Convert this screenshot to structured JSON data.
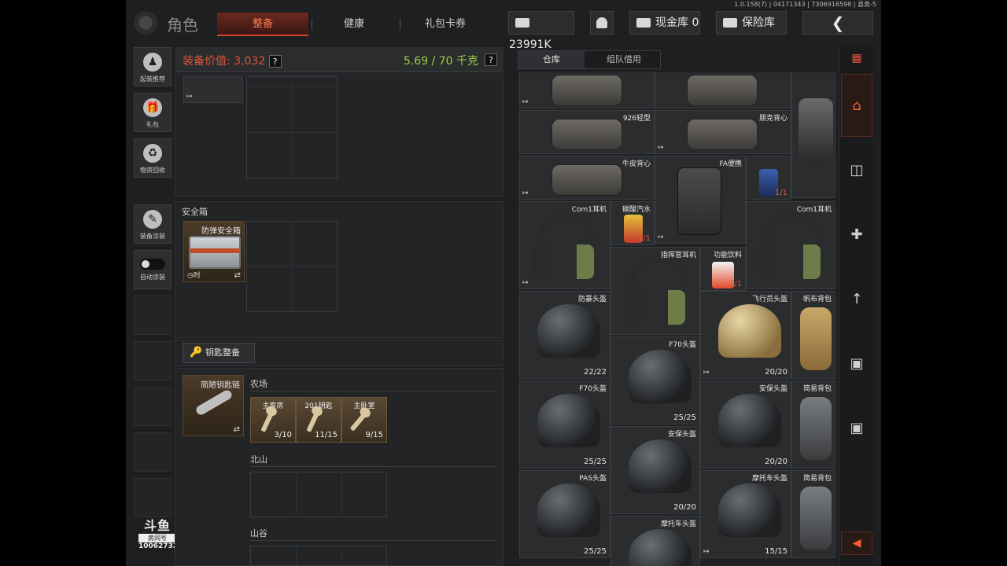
{
  "version": "1.0.158(7) | 04171343 | 7306916598 | 县类-5",
  "header": {
    "title": "角色",
    "tabs": [
      {
        "label": "整备",
        "active": true
      },
      {
        "label": "健康",
        "active": false
      },
      {
        "label": "礼包卡券",
        "active": false
      }
    ],
    "currency": "23991K",
    "cash_vault_label": "现金库 0",
    "safe_label": "保险库",
    "back_icon": "chevron-left-icon"
  },
  "sidebar": {
    "items": [
      {
        "label": "起装推荐",
        "icon": "loadout-icon"
      },
      {
        "label": "礼包",
        "icon": "gift-icon"
      },
      {
        "label": "物资回收",
        "icon": "recycle-icon"
      },
      {
        "label": "装备涂装",
        "icon": "paint-icon"
      },
      {
        "label": "自动涂装",
        "icon": "toggle-icon"
      }
    ],
    "watermark": {
      "brand": "斗鱼",
      "room_label": "房间号",
      "room_number": "10062732"
    }
  },
  "equipment": {
    "value_label": "装备价值: 3,032",
    "weight": "5.69 / 70 千克",
    "help": "?",
    "safe_box": {
      "title": "安全箱",
      "item_name": "防弹安全箱",
      "timer": "时"
    },
    "keys": {
      "button_label": "钥匙整备",
      "holder_name": "简陋钥匙链",
      "regions": [
        {
          "name": "农场",
          "keys": [
            {
              "name": "主客房",
              "count": "3/10"
            },
            {
              "name": "201钥匙",
              "count": "11/15"
            },
            {
              "name": "主卧室",
              "count": "9/15"
            }
          ]
        },
        {
          "name": "北山",
          "keys": []
        },
        {
          "name": "山谷",
          "keys": []
        }
      ]
    }
  },
  "warehouse": {
    "tabs": [
      {
        "label": "仓库",
        "active": true
      },
      {
        "label": "组队借用",
        "active": false
      }
    ],
    "items": [
      {
        "name": "",
        "count": "",
        "shape": "bag"
      },
      {
        "name": "",
        "count": "",
        "shape": "bag"
      },
      {
        "name": "",
        "count": "",
        "shape": "none"
      },
      {
        "name": "926轻型",
        "count": "",
        "shape": "bag"
      },
      {
        "name": "朋克背心",
        "count": "",
        "shape": "bag"
      },
      {
        "name": "",
        "count": "",
        "shape": "tube"
      },
      {
        "name": "牛皮背心",
        "count": "",
        "shape": "bag"
      },
      {
        "name": "FA便携",
        "count": "",
        "shape": "vest"
      },
      {
        "name": "",
        "count": "1/1",
        "shape": "can"
      },
      {
        "name": "Com1耳机",
        "count": "",
        "shape": "earmuff"
      },
      {
        "name": "碳酸汽水",
        "count": "1/1",
        "shape": "can"
      },
      {
        "name": "Com1耳机",
        "count": "",
        "shape": "earmuff"
      },
      {
        "name": "指挥官耳机",
        "count": "",
        "shape": "earmuff"
      },
      {
        "name": "功能饮料",
        "count": "1/1",
        "shape": "drink"
      },
      {
        "name": "防暴头盔",
        "count": "22/22",
        "shape": "helmet"
      },
      {
        "name": "F70头盔",
        "count": "25/25",
        "shape": "helmet"
      },
      {
        "name": "飞行员头盔",
        "count": "20/20",
        "shape": "helmet-tan"
      },
      {
        "name": "帆布背包",
        "count": "",
        "shape": "pack"
      },
      {
        "name": "F70头盔",
        "count": "25/25",
        "shape": "helmet"
      },
      {
        "name": "安保头盔",
        "count": "20/20",
        "shape": "helmet"
      },
      {
        "name": "简易背包",
        "count": "",
        "shape": "pack-gray"
      },
      {
        "name": "安保头盔",
        "count": "20/20",
        "shape": "helmet"
      },
      {
        "name": "PAS头盔",
        "count": "25/25",
        "shape": "helmet"
      },
      {
        "name": "摩托车头盔",
        "count": "15/15",
        "shape": "helmet"
      },
      {
        "name": "简易背包",
        "count": "",
        "shape": "pack-gray"
      },
      {
        "name": "摩托车头盔",
        "count": "",
        "shape": "helmet"
      }
    ]
  },
  "rail": {
    "items": [
      "menu-icon",
      "home-icon",
      "box-icon",
      "medkit-icon",
      "ammo-icon",
      "crate-icon",
      "crate-icon",
      "arrow-left-icon"
    ]
  },
  "colors": {
    "accent": "#e2553a",
    "weight": "#9ed04a",
    "bg": "#1d1f21"
  }
}
